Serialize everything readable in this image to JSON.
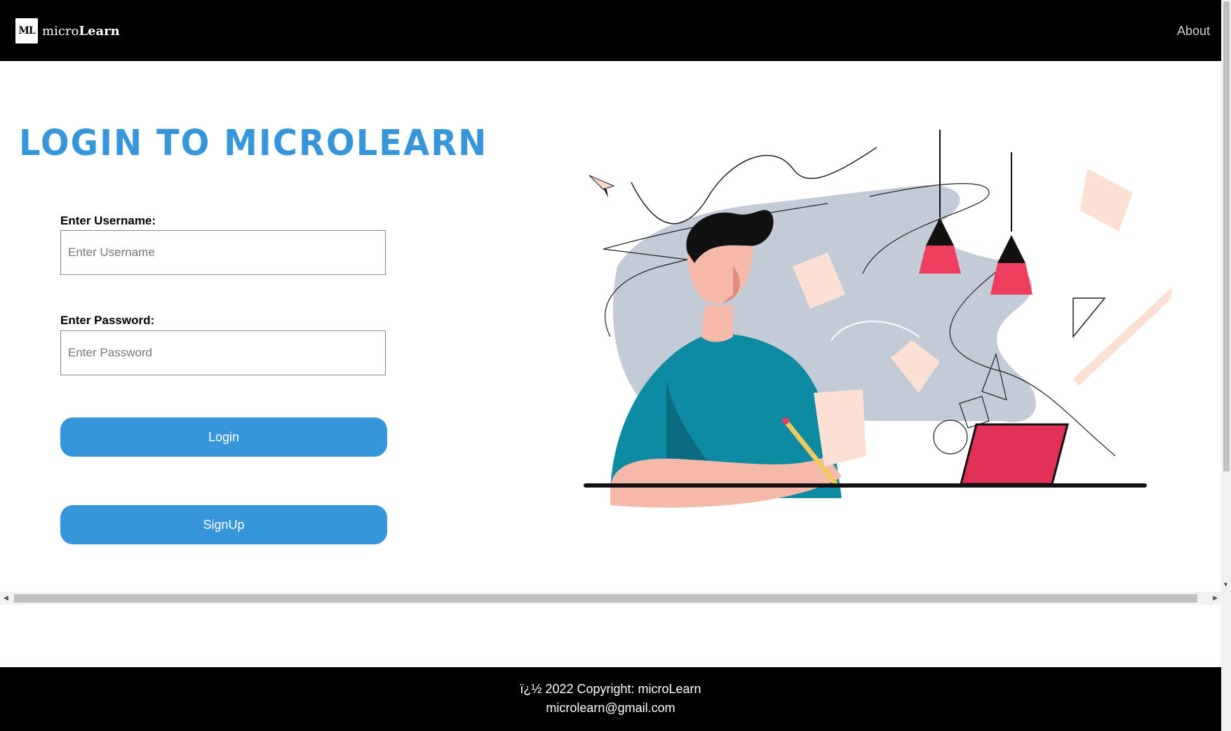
{
  "navbar": {
    "logo_text": "ML",
    "brand_light": "micro",
    "brand_bold": "Learn",
    "about_link": "About"
  },
  "login": {
    "title": "LOGIN TO MICROLEARN",
    "username_label": "Enter Username:",
    "username_placeholder": "Enter Username",
    "username_value": "",
    "password_label": "Enter Password:",
    "password_placeholder": "Enter Password",
    "password_value": "",
    "login_button": "Login",
    "signup_button": "SignUp"
  },
  "illustration": {
    "icon": "person-studying-illustration",
    "colors": {
      "blob": "#c3ccd6",
      "shirt": "#0e8aa3",
      "lamp": "#ef3d5e",
      "paper": "#fbe0d3",
      "laptop": "#e22f55",
      "hair": "#111111",
      "skin": "#f4b9a8"
    }
  },
  "footer": {
    "copyright": "ï¿½ 2022 Copyright: microLearn",
    "email": "microlearn@gmail.com"
  },
  "colors": {
    "accent": "#3795d9",
    "nav_bg": "#000000",
    "footer_bg": "#000000"
  }
}
